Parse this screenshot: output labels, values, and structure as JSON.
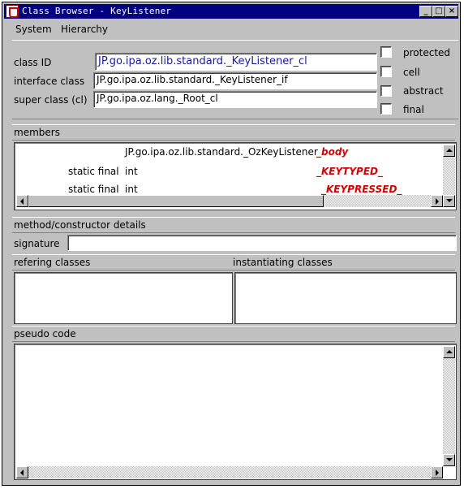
{
  "window": {
    "title": "Class Browser - KeyListener"
  },
  "menu": {
    "items": [
      "System",
      "Hierarchy"
    ]
  },
  "fields": {
    "class_id_label": "class ID",
    "class_id_value": "JP.go.ipa.oz.lib.standard._KeyListener_cl",
    "interface_label": "interface class",
    "interface_value": "JP.go.ipa.oz.lib.standard._KeyListener_if",
    "super_label": "super class (cl)",
    "super_value": "JP.go.ipa.oz.lang._Root_cl"
  },
  "checkboxes": [
    "protected",
    "cell",
    "abstract",
    "final"
  ],
  "members": {
    "label": "members",
    "rows": [
      {
        "modifier": "",
        "type": "JP.go.ipa.oz.lib.standard._OzKeyListener",
        "name": "_body"
      },
      {
        "modifier": "static final",
        "type": "int",
        "name": "_KEYTYPED_"
      },
      {
        "modifier": "static final",
        "type": "int",
        "name": "_KEYPRESSED_"
      }
    ]
  },
  "details": {
    "label": "method/constructor details",
    "signature_label": "signature",
    "signature_value": ""
  },
  "refering": {
    "label": "refering classes"
  },
  "instantiating": {
    "label": "instantiating classes"
  },
  "pseudo": {
    "label": "pseudo code"
  },
  "colors": {
    "titlebar": "#000080",
    "face": "#c0c0c0",
    "field_text_blue": "#1a1aa0",
    "member_name_red": "#d00000"
  }
}
